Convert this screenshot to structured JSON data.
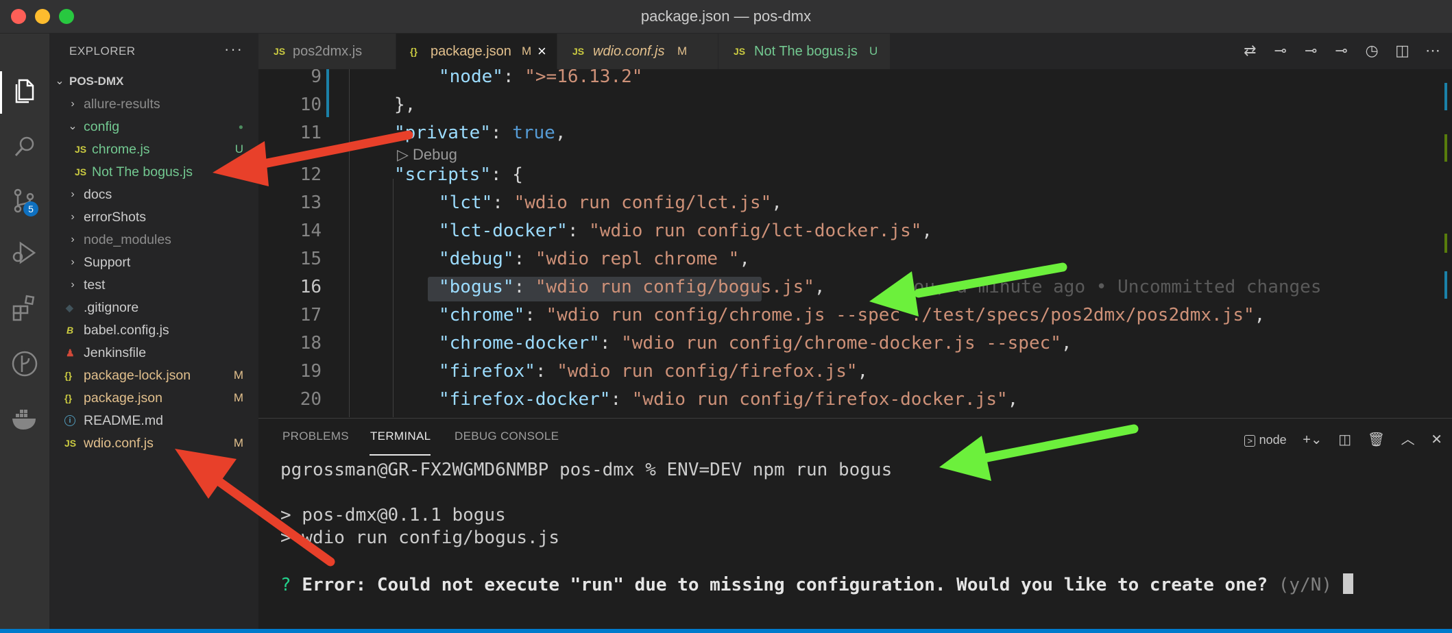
{
  "window": {
    "title": "package.json — pos-dmx"
  },
  "activity_bar": {
    "items": [
      "files-icon",
      "search-icon",
      "source-control-icon",
      "run-debug-icon",
      "extensions-icon",
      "git-graph-icon",
      "docker-icon"
    ],
    "scm_badge": "5"
  },
  "explorer": {
    "title": "EXPLORER",
    "more": "···",
    "root": "POS-DMX",
    "items": [
      {
        "label": "allure-results",
        "deco": ""
      },
      {
        "label": "config",
        "deco": "●"
      },
      {
        "label": "chrome.js",
        "deco": "U",
        "icon": "JS"
      },
      {
        "label": "Not The bogus.js",
        "deco": "",
        "icon": "JS"
      },
      {
        "label": "docs",
        "deco": ""
      },
      {
        "label": "errorShots",
        "deco": ""
      },
      {
        "label": "node_modules",
        "deco": ""
      },
      {
        "label": "Support",
        "deco": ""
      },
      {
        "label": "test",
        "deco": ""
      },
      {
        "label": ".gitignore",
        "deco": ""
      },
      {
        "label": "babel.config.js",
        "deco": "",
        "icon": "B"
      },
      {
        "label": "Jenkinsfile",
        "deco": ""
      },
      {
        "label": "package-lock.json",
        "deco": "M",
        "icon": "{}"
      },
      {
        "label": "package.json",
        "deco": "M",
        "icon": "{}"
      },
      {
        "label": "README.md",
        "deco": "",
        "icon": "i"
      },
      {
        "label": "wdio.conf.js",
        "deco": "M",
        "icon": "JS"
      }
    ]
  },
  "tabs": [
    {
      "icon": "JS",
      "label": "pos2dmx.js",
      "deco": ""
    },
    {
      "icon": "{}",
      "label": "package.json",
      "deco": "M",
      "close": "×"
    },
    {
      "icon": "JS",
      "label": "wdio.conf.js",
      "deco": "M"
    },
    {
      "icon": "JS",
      "label": "Not The bogus.js",
      "deco": "U"
    }
  ],
  "editor": {
    "codelens": "Debug",
    "blame": "You, a minute ago • Uncommitted changes",
    "lines": [
      {
        "n": "9",
        "key": "\"node\"",
        "sep": ": ",
        "val": "\">=16.13.2\"",
        "end": ""
      },
      {
        "n": "10",
        "text": "},"
      },
      {
        "n": "11",
        "key": "\"private\"",
        "sep": ": ",
        "bool": "true",
        "end": ","
      },
      {
        "n": "12",
        "key": "\"scripts\"",
        "sep": ": ",
        "end": "{"
      },
      {
        "n": "13",
        "key": "\"lct\"",
        "sep": ": ",
        "val": "\"wdio run config/lct.js\"",
        "end": ","
      },
      {
        "n": "14",
        "key": "\"lct-docker\"",
        "sep": ": ",
        "val": "\"wdio run config/lct-docker.js\"",
        "end": ","
      },
      {
        "n": "15",
        "key": "\"debug\"",
        "sep": ": ",
        "val": "\"wdio repl chrome \"",
        "end": ","
      },
      {
        "n": "16",
        "key": "\"bogus\"",
        "sep": ": ",
        "val": "\"wdio run config/bogus.js\"",
        "end": ","
      },
      {
        "n": "17",
        "key": "\"chrome\"",
        "sep": ": ",
        "val": "\"wdio run config/chrome.js --spec ./test/specs/pos2dmx/pos2dmx.js\"",
        "end": ","
      },
      {
        "n": "18",
        "key": "\"chrome-docker\"",
        "sep": ": ",
        "val": "\"wdio run config/chrome-docker.js --spec\"",
        "end": ","
      },
      {
        "n": "19",
        "key": "\"firefox\"",
        "sep": ": ",
        "val": "\"wdio run config/firefox.js\"",
        "end": ","
      },
      {
        "n": "20",
        "key": "\"firefox-docker\"",
        "sep": ": ",
        "val": "\"wdio run config/firefox-docker.js\"",
        "end": ","
      }
    ]
  },
  "panel": {
    "tabs": [
      "PROBLEMS",
      "TERMINAL",
      "DEBUG CONSOLE"
    ],
    "shell": "node",
    "terminal": {
      "prompt": "pgrossman@GR-FX2WGMD6NMBP pos-dmx % ENV=DEV npm run bogus",
      "out1": "> pos-dmx@0.1.1 bogus",
      "out2": "> wdio run config/bogus.js",
      "q": "?",
      "error": "Error: Could not execute \"run\" due to missing configuration. Would you like to create one?",
      "hint": "(y/N)"
    }
  },
  "colors": {
    "red_arrow": "#e8402a",
    "green_arrow": "#6cf03c",
    "accent": "#007acc"
  }
}
